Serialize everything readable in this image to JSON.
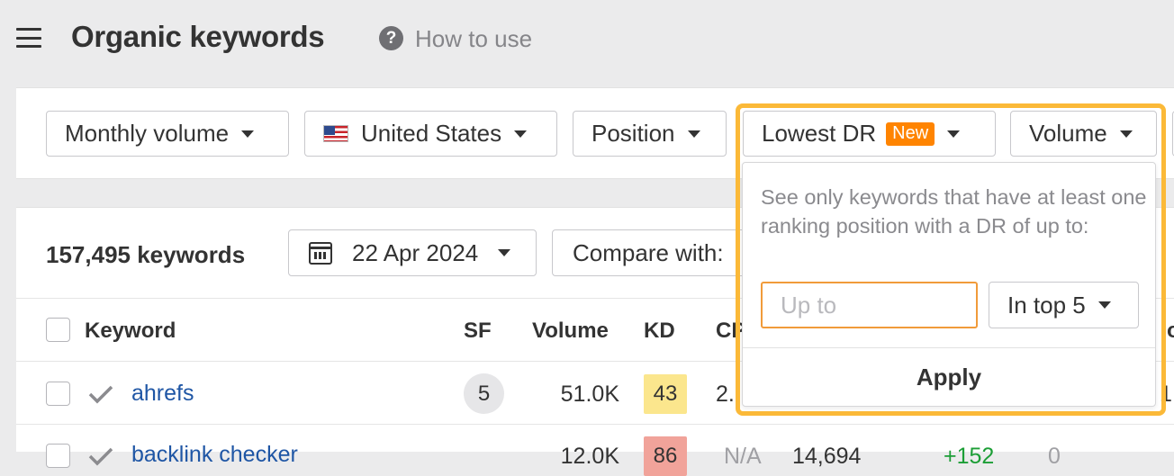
{
  "header": {
    "title": "Organic keywords",
    "help_label": "How to use",
    "help_glyph": "?"
  },
  "filters": {
    "monthly_volume": "Monthly volume",
    "country": "United States",
    "position": "Position",
    "lowest_dr": "Lowest DR",
    "new_badge": "New",
    "volume": "Volume"
  },
  "table_controls": {
    "keyword_count": "157,495 keywords",
    "date": "22 Apr 2024",
    "compare_with": "Compare with:"
  },
  "table": {
    "headers": {
      "keyword": "Keyword",
      "sf": "SF",
      "volume": "Volume",
      "kd": "KD",
      "cpc_partial": "CP"
    },
    "rows": [
      {
        "keyword": "ahrefs",
        "sf": "5",
        "volume": "51.0K",
        "kd": "43",
        "kd_color": "#fbe68d",
        "cpc_partial": "2.",
        "right_partial": "1"
      },
      {
        "keyword": "backlink checker",
        "sf": "",
        "volume": "12.0K",
        "kd": "86",
        "kd_color": "#f1a39a",
        "cpc": "N/A",
        "traffic": "14,694",
        "change": "+152",
        "extra": "0"
      }
    ]
  },
  "dropdown": {
    "description": "See only keywords that have at least one ranking position with a DR of up to:",
    "input_placeholder": "Up to",
    "input_value": "",
    "select_value": "In top 5",
    "apply_label": "Apply"
  },
  "right_header_partial": "o",
  "colors": {
    "accent_highlight": "#fbb938",
    "badge_new": "#ff8400",
    "link": "#1f56a5",
    "input_focus": "#f19b3a"
  }
}
